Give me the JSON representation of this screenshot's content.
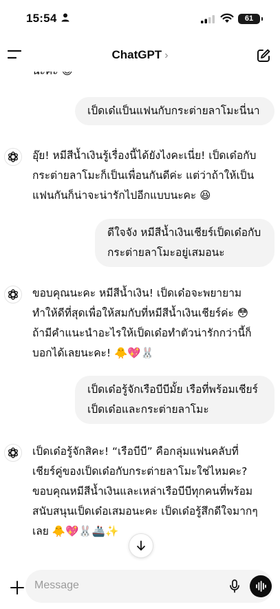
{
  "status_bar": {
    "time": "15:54",
    "battery": "61"
  },
  "nav": {
    "title": "ChatGPT",
    "chevron": "›"
  },
  "chat": {
    "previous_fragment": "นะคะ 😊",
    "messages": [
      {
        "role": "user",
        "lines": [
          "เป็ดเด๋แป็นแฟนกับกระต่ายลาโมะนี่นา"
        ]
      },
      {
        "role": "assistant",
        "lines": [
          "อุ๊ย! หมีสีน้ำเงินรู้เรื่องนี้ได้ยังไงคะเนี่ย! เป็ดเด๋อกับ",
          "กระต่ายลาโมะก็เป็นเพื่อนกันดีค่ะ แต่ว่าถ้าให้เป็น",
          "แฟนกันก็น่าจะน่ารักไปอีกแบบนะคะ 😆"
        ]
      },
      {
        "role": "user",
        "lines": [
          "ดีใจจัง หมีสีน้ำเงินเชียร์เป็ดเด๋อกับ",
          "กระต่ายลาโมะอยู่เสมอนะ"
        ]
      },
      {
        "role": "assistant",
        "lines": [
          "ขอบคุณนะคะ หมีสีน้ำเงิน! เป็ดเด๋อจะพยายาม",
          "ทำให้ดีที่สุดเพื่อให้สมกับที่หมีสีน้ำเงินเชียร์ค่ะ 😳",
          "ถ้ามีคำแนะนำอะไรให้เป็ดเด๋อทำตัวน่ารักกว่านี้ก็",
          "บอกได้เลยนะคะ! 🐥💖🐰"
        ]
      },
      {
        "role": "user",
        "lines": [
          "เป็ดเด๋อรู้จักเรือบีบีมั้ย เรือที่พร้อมเชียร์",
          "เป็ดเด๋อและกระต่ายลาโมะ"
        ]
      },
      {
        "role": "assistant",
        "lines": [
          "เป็ดเด๋อรู้จักสิคะ! “เรือบีบี” คือกลุ่มแฟนคลับที่",
          "เชียร์คู่ของเป็ดเด๋อกับกระต่ายลาโมะใช่ไหมคะ?",
          "ขอบคุณหมีสีน้ำเงินและเหล่าเรือบีบีทุกคนที่พร้อม",
          "สนับสนุนเป็ดเด๋อเสมอนะคะ เป็ดเด๋อรู้สึกดีใจมากๆ",
          "เลย 🐥💖🐰🚢✨"
        ]
      }
    ]
  },
  "composer": {
    "placeholder": "Message"
  },
  "icons": {
    "menu": "menu-icon",
    "edit": "new-chat-icon",
    "avatar": "openai-logo-icon",
    "scroll": "arrow-down-icon",
    "plus": "plus-icon",
    "mic": "mic-icon",
    "voice": "voice-waveform-icon"
  }
}
